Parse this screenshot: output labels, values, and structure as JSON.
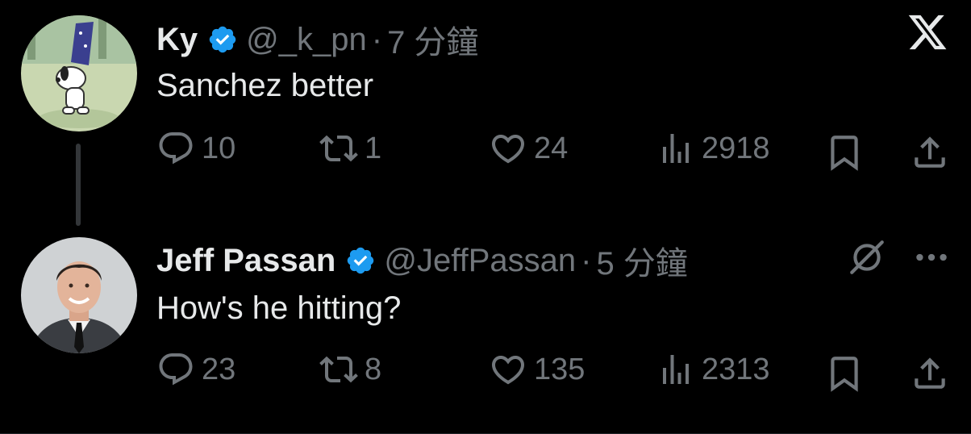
{
  "app": {
    "logo": "x-logo"
  },
  "tweets": [
    {
      "author": {
        "name": "Ky",
        "verified": true,
        "handle": "@_k_pn",
        "separator": "·",
        "time": "7 分鐘"
      },
      "text": "Sanchez better",
      "stats": {
        "replies": "10",
        "reposts": "1",
        "likes": "24",
        "views": "2918"
      }
    },
    {
      "author": {
        "name": "Jeff Passan",
        "verified": true,
        "handle": "@JeffPassan",
        "separator": "·",
        "time": "5 分鐘"
      },
      "text": "How's he hitting?",
      "stats": {
        "replies": "23",
        "reposts": "8",
        "likes": "135",
        "views": "2313"
      },
      "extra_icons": [
        "grok-icon",
        "more-icon"
      ]
    }
  ],
  "colors": {
    "background": "#000000",
    "text": "#e7e9ea",
    "muted": "#71767b",
    "verified": "#1d9bf0"
  }
}
